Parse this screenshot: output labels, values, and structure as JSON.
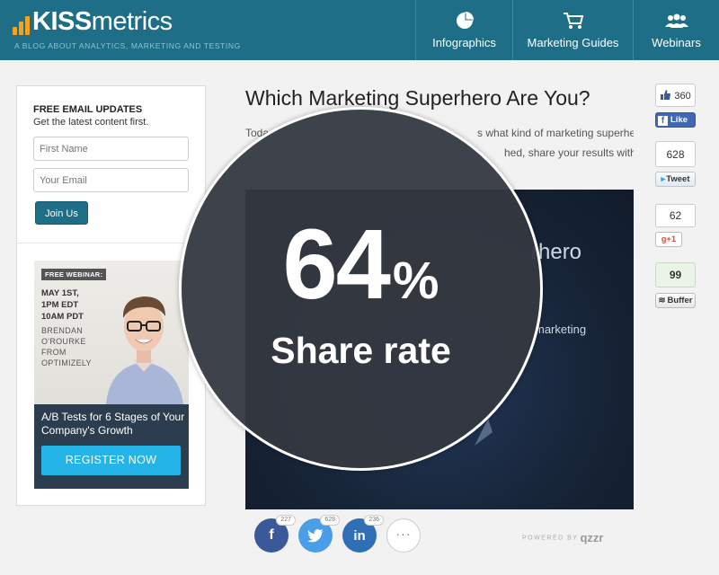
{
  "header": {
    "logo_bold": "KISS",
    "logo_rest": "metrics",
    "tagline": "A BLOG ABOUT ANALYTICS, MARKETING AND TESTING",
    "nav": [
      {
        "label": "Infographics",
        "icon": "pie-chart-icon"
      },
      {
        "label": "Marketing Guides",
        "icon": "shopping-cart-icon"
      },
      {
        "label": "Webinars",
        "icon": "people-icon"
      }
    ],
    "brand_color": "#1f6e87",
    "logo_accent": "#f7a21b"
  },
  "signup": {
    "title": "FREE EMAIL UPDATES",
    "subtitle": "Get the latest content first.",
    "first_name_placeholder": "First Name",
    "email_placeholder": "Your Email",
    "button": "Join Us"
  },
  "ad": {
    "tag": "FREE WEBINAR:",
    "date_line1": "MAY 1ST,",
    "date_line2": "1PM EDT",
    "date_line3": "10AM PDT",
    "speaker_line1": "BRENDAN",
    "speaker_line2": "O'ROURKE",
    "speaker_line3": "FROM",
    "speaker_line4": "OPTIMIZELY",
    "title": "A/B Tests for 6 Stages of Your Company's Growth",
    "button": "REGISTER NOW",
    "button_color": "#25b4e8"
  },
  "post": {
    "title": "Which Marketing Superhero Are You?",
    "intro_line1_start": "Toda",
    "intro_line1_end": "s what kind of marketing superhero",
    "intro_line2_end": "hed, share your results with your",
    "quiz_text1": "rhero",
    "quiz_text2": "marketing"
  },
  "share_bar": {
    "facebook_count": "227",
    "twitter_count": "628",
    "linkedin_count": "236",
    "more": "···",
    "powered_by": "POWERED BY",
    "powered_brand": "qzzr"
  },
  "social": {
    "facebook_count": "360",
    "facebook_label": "Like",
    "tweet_count": "628",
    "tweet_label": "Tweet",
    "gplus_count": "62",
    "gplus_label": "+1",
    "buffer_count": "99",
    "buffer_label": "Buffer"
  },
  "overlay": {
    "value": "64",
    "unit": "%",
    "label": "Share rate"
  }
}
